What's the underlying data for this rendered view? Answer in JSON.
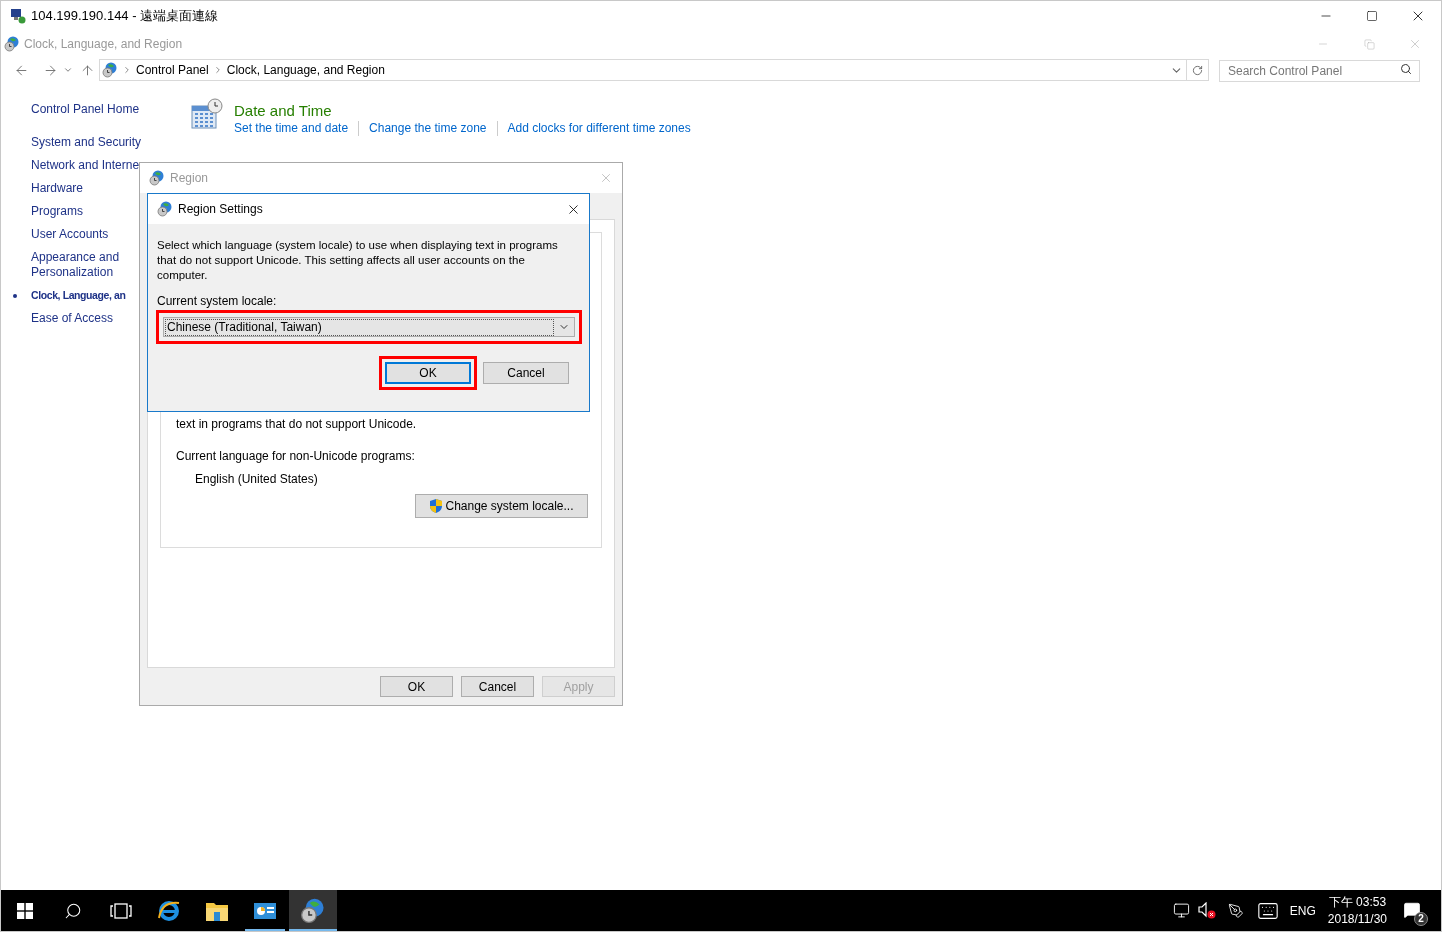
{
  "remote_window": {
    "title": "104.199.190.144 - 遠端桌面連線"
  },
  "explorer": {
    "title": "Clock, Language, and Region",
    "breadcrumb": [
      "Control Panel",
      "Clock, Language, and Region"
    ],
    "search": {
      "placeholder": "Search Control Panel"
    },
    "sidebar": [
      {
        "label": "Control Panel Home",
        "selected": false
      },
      {
        "label": "System and Security",
        "selected": false
      },
      {
        "label": "Network and Interne",
        "selected": false
      },
      {
        "label": "Hardware",
        "selected": false
      },
      {
        "label": "Programs",
        "selected": false
      },
      {
        "label": "User Accounts",
        "selected": false
      },
      {
        "label": "Appearance and Personalization",
        "selected": false
      },
      {
        "label": "Clock, Language, an",
        "selected": true
      },
      {
        "label": "Ease of Access",
        "selected": false
      }
    ],
    "categories": [
      {
        "title": "Date and Time",
        "links": [
          "Set the time and date",
          "Change the time zone",
          "Add clocks for different time zones"
        ]
      }
    ]
  },
  "region_dialog": {
    "title": "Region",
    "text": "text in programs that do not support Unicode.",
    "current_language_label": "Current language for non-Unicode programs:",
    "current_language": "English (United States)",
    "change_button": "Change system locale...",
    "buttons": [
      {
        "label": "OK",
        "disabled": false
      },
      {
        "label": "Cancel",
        "disabled": false
      },
      {
        "label": "Apply",
        "disabled": true
      }
    ]
  },
  "region_settings": {
    "title": "Region Settings",
    "description": "Select which language (system locale) to use when displaying text in programs that do not support Unicode. This setting affects all user accounts on the computer.",
    "locale_label": "Current system locale:",
    "locale_value": "Chinese (Traditional, Taiwan)",
    "locale_highlighted": true,
    "buttons": [
      {
        "label": "OK",
        "default": true,
        "highlighted": true
      },
      {
        "label": "Cancel",
        "default": false,
        "highlighted": false
      }
    ]
  },
  "taskbar": {
    "apps": [
      {
        "kind": "ie",
        "active": false,
        "running": false
      },
      {
        "kind": "folder",
        "active": false,
        "running": false
      },
      {
        "kind": "control-panel",
        "active": false,
        "running": true
      },
      {
        "kind": "region",
        "active": true,
        "running": true
      }
    ],
    "language": "ENG",
    "time": "下午 03:53",
    "date": "2018/11/30",
    "notifications": "2"
  }
}
